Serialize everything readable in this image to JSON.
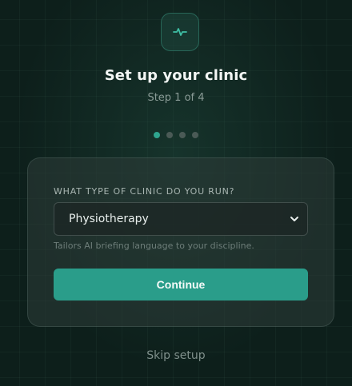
{
  "header": {
    "logo_icon": "pulse-icon",
    "title": "Set up your clinic",
    "step_text": "Step 1 of 4"
  },
  "progress": {
    "total_steps": 4,
    "current_step": 1
  },
  "form": {
    "clinic_type_label": "WHAT TYPE OF CLINIC DO YOU RUN?",
    "clinic_type_value": "Physiotherapy",
    "hint": "Tailors AI briefing language to your discipline.",
    "continue_label": "Continue"
  },
  "footer": {
    "skip_label": "Skip setup"
  },
  "colors": {
    "accent": "#2a9d8a",
    "background": "#0d1f1b"
  }
}
